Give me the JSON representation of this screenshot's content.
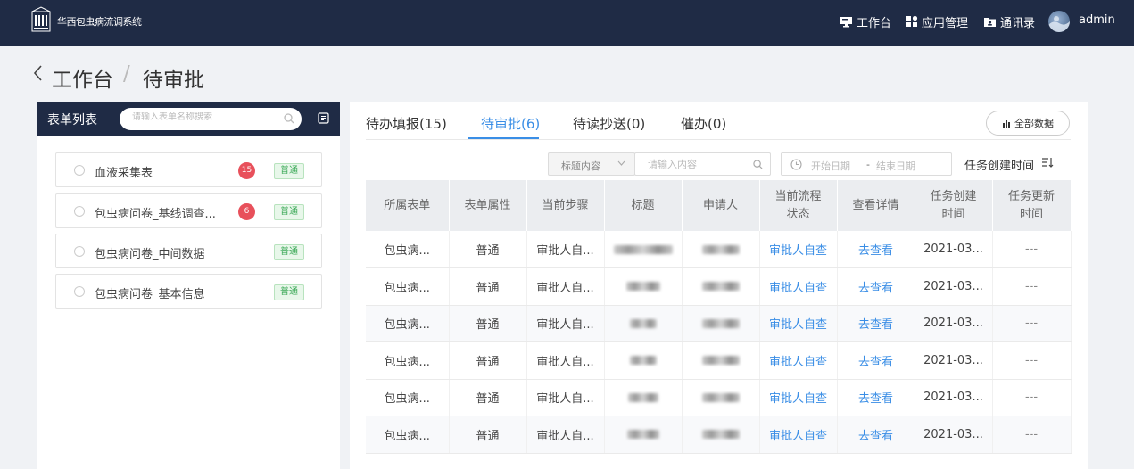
{
  "header": {
    "app_title": "华西包虫病流调系统",
    "nav": [
      {
        "label": "工作台",
        "icon": "monitor-icon"
      },
      {
        "label": "应用管理",
        "icon": "apps-icon"
      },
      {
        "label": "通讯录",
        "icon": "contacts-icon"
      }
    ],
    "user_name": "admin"
  },
  "breadcrumb": {
    "parent": "工作台",
    "separator": "/",
    "current": "待审批"
  },
  "left_panel": {
    "title": "表单列表",
    "search_placeholder": "请输入表单名称搜索",
    "forms": [
      {
        "name": "血液采集表",
        "count": "15",
        "type": "普通"
      },
      {
        "name": "包虫病问卷_基线调查...",
        "count": "6",
        "type": "普通"
      },
      {
        "name": "包虫病问卷_中间数据",
        "count": "",
        "type": "普通"
      },
      {
        "name": "包虫病问卷_基本信息",
        "count": "",
        "type": "普通"
      }
    ]
  },
  "tabs": [
    {
      "label": "待办填报(15)",
      "active": false
    },
    {
      "label": "待审批(6)",
      "active": true
    },
    {
      "label": "待读抄送(0)",
      "active": false
    },
    {
      "label": "催办(0)",
      "active": false
    }
  ],
  "all_data_button": "全部数据",
  "filters": {
    "field_select": "标题内容",
    "search_placeholder": "请输入内容",
    "date_start_placeholder": "开始日期",
    "date_separator": "-",
    "date_end_placeholder": "结束日期",
    "sort_label": "任务创建时间"
  },
  "table": {
    "columns": [
      "所属表单",
      "表单属性",
      "当前步骤",
      "标题",
      "申请人",
      "当前流程状态",
      "查看详情",
      "任务创建时间",
      "任务更新时间"
    ],
    "rows": [
      [
        "包虫病...",
        "普通",
        "审批人自...",
        "",
        "",
        "审批人自查",
        "去查看",
        "2021-03...",
        "---"
      ],
      [
        "包虫病...",
        "普通",
        "审批人自...",
        "",
        "",
        "审批人自查",
        "去查看",
        "2021-03...",
        "---"
      ],
      [
        "包虫病...",
        "普通",
        "审批人自...",
        "",
        "",
        "审批人自查",
        "去查看",
        "2021-03...",
        "---"
      ],
      [
        "包虫病...",
        "普通",
        "审批人自...",
        "",
        "",
        "审批人自查",
        "去查看",
        "2021-03...",
        "---"
      ],
      [
        "包虫病...",
        "普通",
        "审批人自...",
        "",
        "",
        "审批人自查",
        "去查看",
        "2021-03...",
        "---"
      ],
      [
        "包虫病...",
        "普通",
        "审批人自...",
        "",
        "",
        "审批人自查",
        "去查看",
        "2021-03...",
        "---"
      ]
    ]
  },
  "colors": {
    "header_bg": "#1f2b45",
    "accent": "#3a8ee6",
    "badge_red": "#e8505b",
    "tag_green": "#3aa856"
  }
}
